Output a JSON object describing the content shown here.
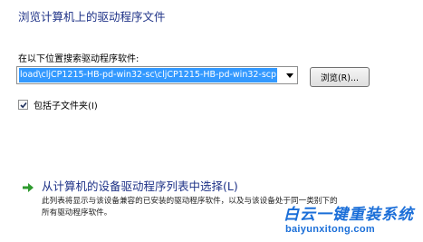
{
  "dialog": {
    "title": "浏览计算机上的驱动程序文件",
    "search_label": "在以下位置搜索驱动程序软件:",
    "path_value": "load\\cljCP1215-HB-pd-win32-sc\\cljCP1215-HB-pd-win32-scp",
    "browse_label": "浏览(R)...",
    "include_subfolders_label": "包括子文件夹(I)",
    "include_subfolders_checked": true,
    "pick_option": {
      "title": "从计算机的设备驱动程序列表中选择(L)",
      "description_line1": "此列表将显示与该设备兼容的已安装的驱动程序软件，以及与该设备处于同一类别下的",
      "description_line2": "所有驱动程序软件。"
    }
  },
  "watermark": {
    "name": "白云一键重装系统",
    "url": "baiyunxitong.com"
  },
  "colors": {
    "title_blue": "#1e3287",
    "selection_blue": "#3399ff",
    "arrow_green": "#2e9a2e",
    "watermark_blue": "#1a6ed8"
  },
  "icons": {
    "combo": "chevron-down-icon",
    "checkbox": "checkmark-icon",
    "option": "green-arrow-icon"
  }
}
